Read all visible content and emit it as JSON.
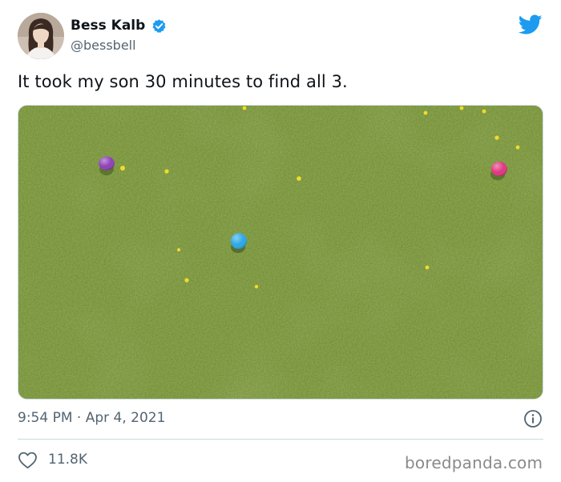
{
  "author": {
    "name": "Bess Kalb",
    "handle": "@bessbell",
    "verified": true
  },
  "tweet": {
    "text": "It took my son 30 minutes to find all 3.",
    "timestamp": "9:54 PM · Apr 4, 2021",
    "likes": "11.8K"
  },
  "icons": {
    "platform": "twitter-bird-icon",
    "verified": "verified-badge-icon",
    "info": "info-icon",
    "like": "heart-icon"
  },
  "colors": {
    "brand_blue": "#1d9bf0",
    "egg_purple": "#8e3fb8",
    "egg_pink": "#e0357f",
    "egg_blue": "#2aa7e6",
    "grass": "#6f8a34"
  },
  "watermark": "boredpanda.com"
}
